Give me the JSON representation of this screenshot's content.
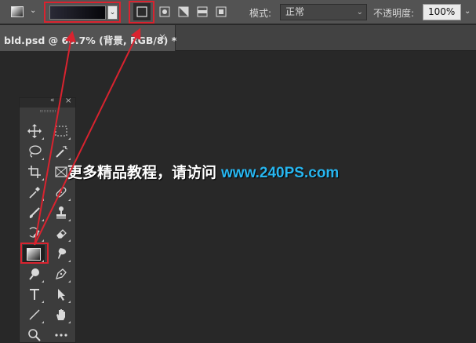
{
  "options_bar": {
    "tool_preset_icon": "gradient-tool-preset-icon",
    "gradient_picker": {
      "colors": [
        "#2a2a36",
        "#06060a"
      ]
    },
    "gradient_types": [
      "linear-gradient-icon",
      "radial-gradient-icon",
      "angle-gradient-icon",
      "reflected-gradient-icon",
      "diamond-gradient-icon"
    ],
    "mode_label": "模式:",
    "mode_value": "正常",
    "opacity_label": "不透明度:",
    "opacity_value": "100%"
  },
  "document_tab": {
    "title": "bld.psd @ 66.7% (背景, RGB/8) *",
    "close": "×"
  },
  "tools_panel": {
    "collapse": "«",
    "close": "×",
    "tools": [
      "move-icon",
      "marquee-icon",
      "lasso-icon",
      "magic-wand-icon",
      "crop-icon",
      "frame-icon",
      "eyedropper-icon",
      "healing-brush-icon",
      "brush-icon",
      "clone-stamp-icon",
      "history-brush-icon",
      "eraser-icon",
      "gradient-icon",
      "smudge-icon",
      "dodge-icon",
      "pen-icon",
      "type-icon",
      "path-selection-icon",
      "line-icon",
      "hand-icon",
      "zoom-icon",
      "more-tools-icon"
    ]
  },
  "watermark": {
    "text_cn": "更多精品教程，请访问",
    "text_url": "www.240PS.com"
  },
  "colors": {
    "highlight": "#d9232f",
    "url": "#27b6f0"
  }
}
